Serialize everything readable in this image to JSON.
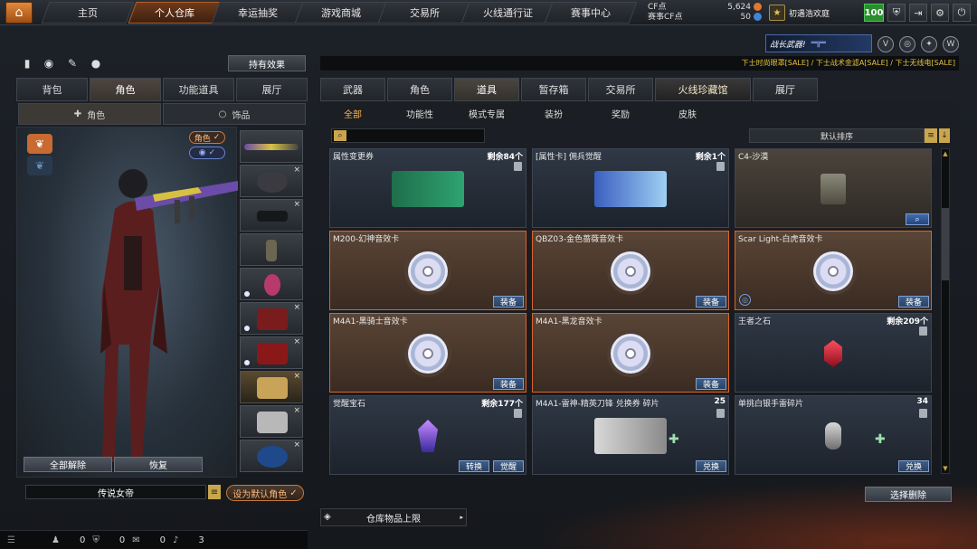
{
  "topnav": {
    "items": [
      "主页",
      "个人仓库",
      "幸运抽奖",
      "游戏商城",
      "交易所",
      "火线通行证",
      "赛事中心"
    ],
    "active": "个人仓库"
  },
  "currency": {
    "cf_label": "CF点",
    "cf_value": "5,624",
    "event_cf_label": "赛事CF点",
    "event_cf_value": "50"
  },
  "user": {
    "name": "初遇浩欢庭",
    "level": "100"
  },
  "banner": {
    "text": "战长武器!"
  },
  "ticker": "下士时尚眼罩[SALE] / 下士战术金滤A[SALE] / 下士无线电[SALE]",
  "left": {
    "held_effect_label": "持有效果",
    "tabs": [
      "背包",
      "角色",
      "功能道具",
      "展厅"
    ],
    "active_tab": "角色",
    "subtabs": [
      "角色",
      "饰品"
    ],
    "active_subtab": "角色",
    "pill_role_label": "角色",
    "unequip_all_label": "全部解除",
    "restore_label": "恢复",
    "character_name": "传说女帝",
    "set_default_label": "设为默认角色"
  },
  "right": {
    "tabs": [
      "武器",
      "角色",
      "道具",
      "暂存箱",
      "交易所",
      "火线珍藏馆",
      "展厅"
    ],
    "active_tab": "道具",
    "subtabs": [
      "全部",
      "功能性",
      "模式专属",
      "装扮",
      "奖励",
      "皮肤"
    ],
    "active_subtab": "全部",
    "sort_label": "默认排序",
    "select_delete_label": "选择删除",
    "capacity_label": "仓库物品上限"
  },
  "items": [
    {
      "name": "属性变更券",
      "remain": "剩余84个",
      "type": "ticket-green",
      "actions": []
    },
    {
      "name": "[属性卡] 佣兵觉醒",
      "remain": "剩余1个",
      "type": "ticket-blue",
      "actions": []
    },
    {
      "name": "C4-沙漠",
      "remain": "",
      "type": "c4",
      "actions": [],
      "magnify": true
    },
    {
      "name": "M200-幻神音效卡",
      "remain": "",
      "type": "sound",
      "actions": [
        "装备"
      ]
    },
    {
      "name": "QBZ03-金色蔷薇音效卡",
      "remain": "",
      "type": "sound",
      "actions": [
        "装备"
      ]
    },
    {
      "name": "Scar Light-白虎音效卡",
      "remain": "",
      "type": "sound",
      "actions": [
        "装备"
      ]
    },
    {
      "name": "M4A1-黑骑士音效卡",
      "remain": "",
      "type": "sound",
      "actions": [
        "装备"
      ]
    },
    {
      "name": "M4A1-黑龙音效卡",
      "remain": "",
      "type": "sound",
      "actions": [
        "装备"
      ]
    },
    {
      "name": "王者之石",
      "remain": "剩余209个",
      "type": "gem-red",
      "actions": []
    },
    {
      "name": "觉醒宝石",
      "remain": "剩余177个",
      "type": "gem-purple",
      "actions": [
        "转换",
        "觉醒"
      ]
    },
    {
      "name": "M4A1-雷神-精英刀锋 兑换券 碎片",
      "remain": "25",
      "type": "coupon",
      "actions": [
        "兑换"
      ]
    },
    {
      "name": "单挑白银手雷碎片",
      "remain": "34",
      "type": "grenade",
      "actions": [
        "兑换"
      ]
    }
  ],
  "footer": {
    "c1": "0",
    "c2": "0",
    "c3": "0",
    "c4": "3"
  },
  "colors": {
    "accent": "#d9642b",
    "gold": "#e5c23c",
    "level_green": "#2a8d2f"
  }
}
